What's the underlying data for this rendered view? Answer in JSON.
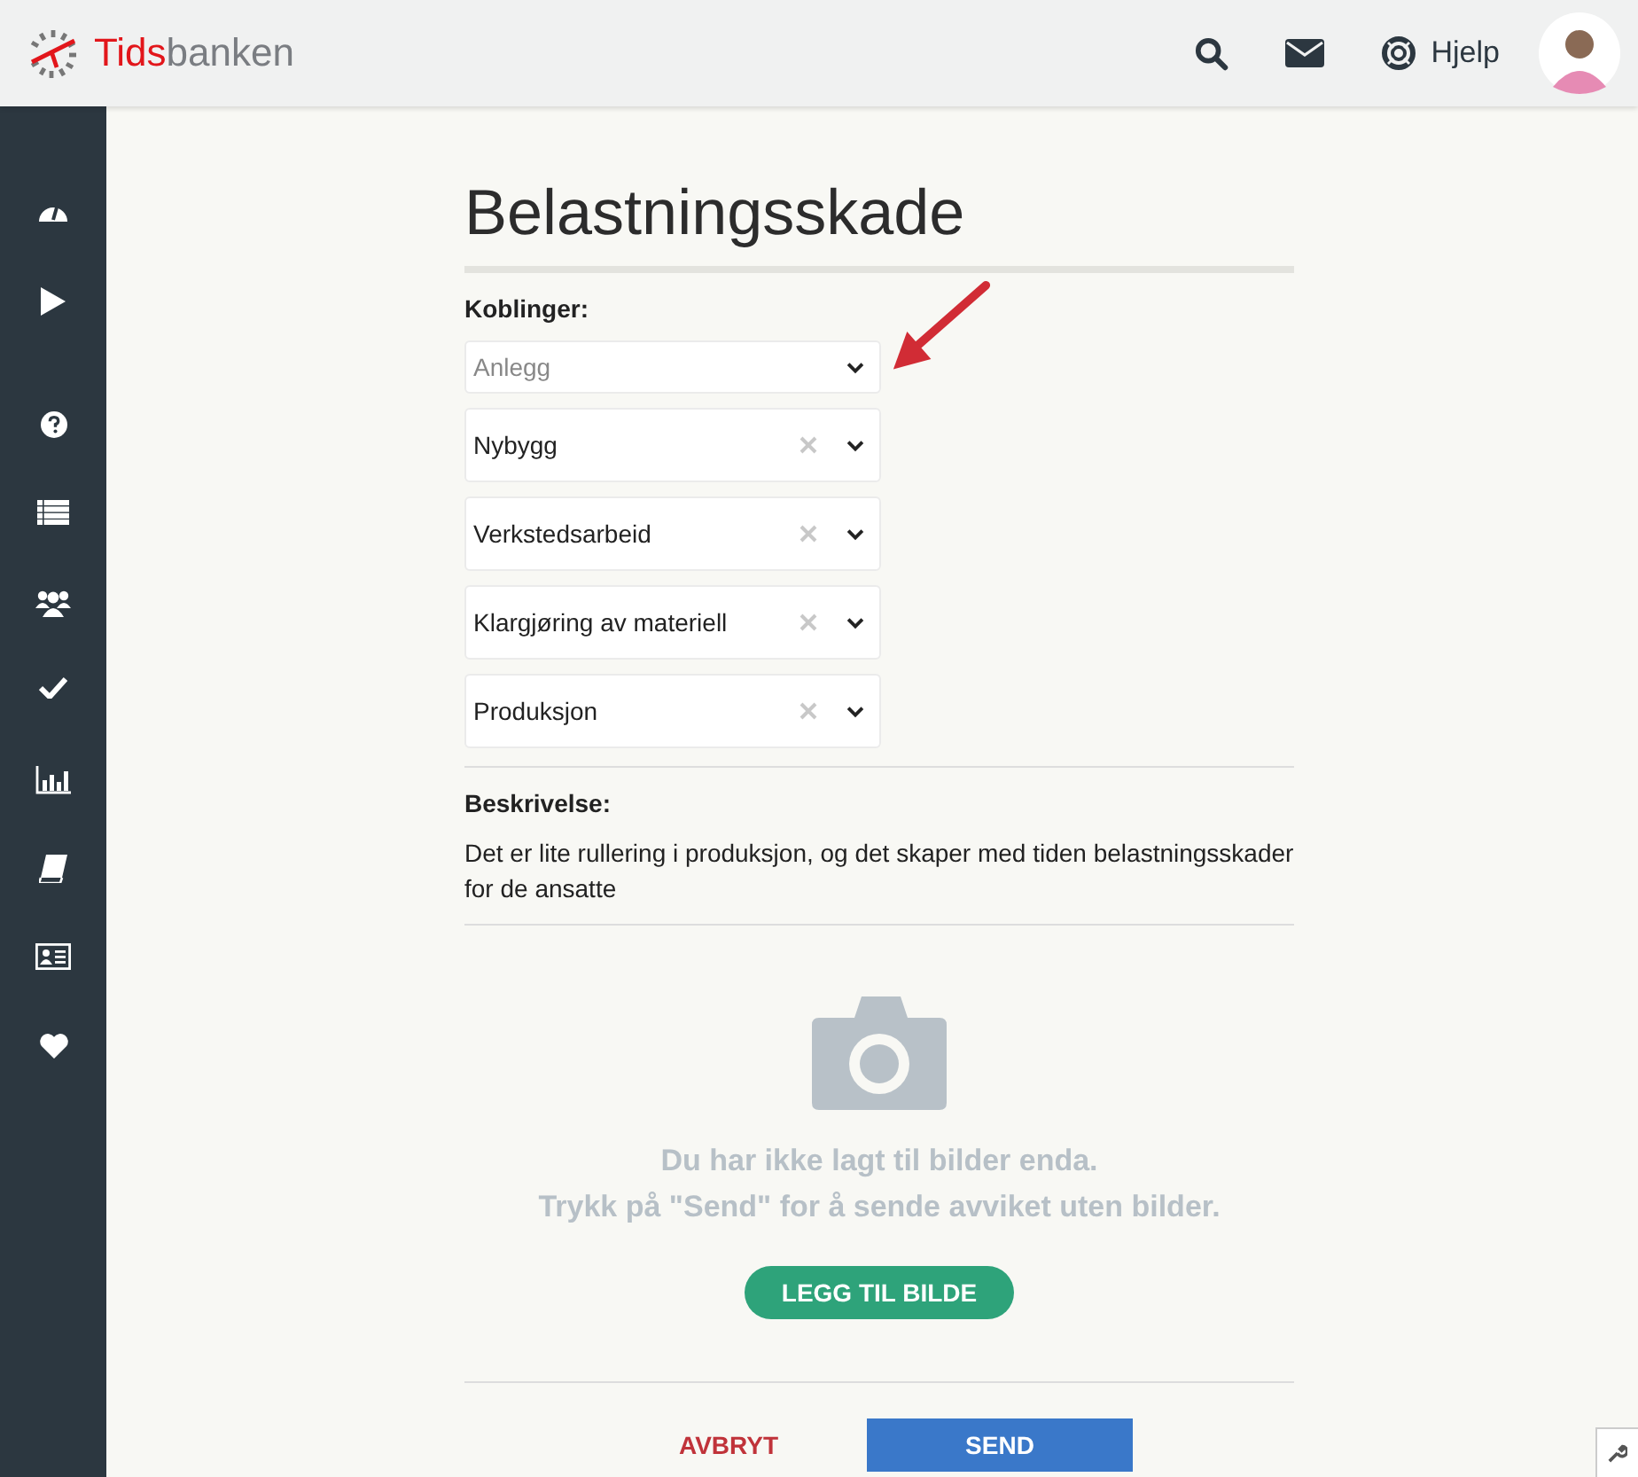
{
  "header": {
    "logo": {
      "first": "Tids",
      "rest": "banken"
    },
    "help_label": "Hjelp"
  },
  "sidebar": {
    "items": [
      {
        "kind": "dashboard"
      },
      {
        "kind": "play"
      },
      {
        "kind": "help"
      },
      {
        "kind": "list"
      },
      {
        "kind": "users"
      },
      {
        "kind": "check"
      },
      {
        "kind": "chart"
      },
      {
        "kind": "book"
      },
      {
        "kind": "card"
      },
      {
        "kind": "heart"
      }
    ]
  },
  "title": "Belastningsskade",
  "links_label": "Koblinger:",
  "links": [
    {
      "placeholder": "Anlegg"
    },
    {
      "value": "Nybygg"
    },
    {
      "value": "Verkstedsarbeid"
    },
    {
      "value": "Klargjøring av materiell"
    },
    {
      "value": "Produksjon"
    }
  ],
  "description_label": "Beskrivelse:",
  "description": "Det er lite rullering i produksjon, og det skaper med tiden belastningsskader for de ansatte",
  "photos": {
    "empty_lines": [
      "Du har ikke lagt til bilder enda.",
      "Trykk på \"Send\" for å sende avviket uten bilder."
    ],
    "add_button": "LEGG TIL BILDE"
  },
  "cancel_button": "AVBRYT",
  "send_button": "SEND"
}
